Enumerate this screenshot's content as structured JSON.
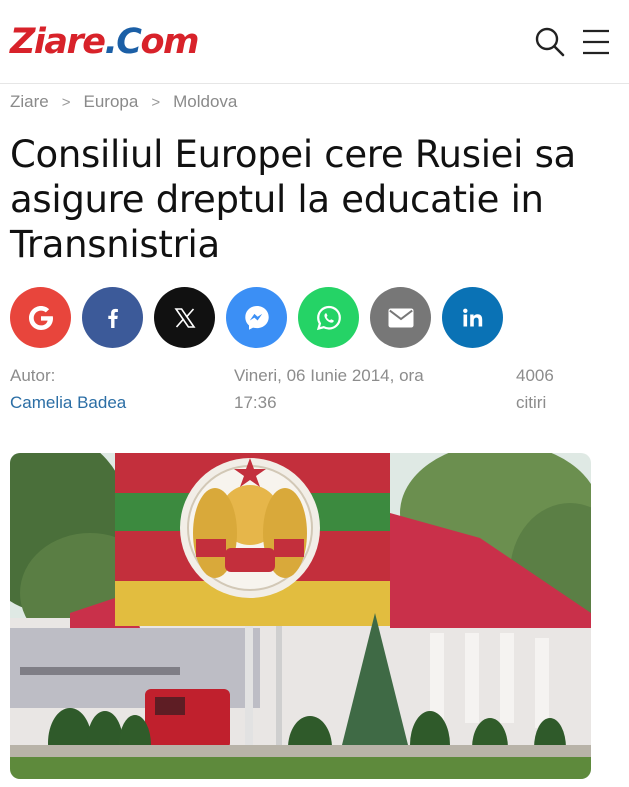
{
  "header": {
    "logo_part1": "Ziare",
    "logo_part2": ".C",
    "logo_part3": "om",
    "search_icon": "search-icon",
    "menu_icon": "hamburger-menu-icon"
  },
  "breadcrumb": {
    "items": [
      "Ziare",
      "Europa",
      "Moldova"
    ],
    "separator": ">"
  },
  "article": {
    "title": "Consiliul Europei cere Rusiei sa asigure dreptul la educatie in Transnistria",
    "author_label": "Autor:",
    "author_name": "Camelia Badea",
    "date_line1": "Vineri, 06 Iunie 2014, ora",
    "date_line2": "17:36",
    "reads_count": "4006",
    "reads_label": "citiri"
  },
  "share": [
    {
      "name": "google",
      "icon": "google-icon",
      "color": "#e8453c"
    },
    {
      "name": "facebook",
      "icon": "facebook-icon",
      "color": "#3c5a99"
    },
    {
      "name": "x",
      "icon": "x-icon",
      "color": "#111111"
    },
    {
      "name": "messenger",
      "icon": "messenger-icon",
      "color": "#3b8ff5"
    },
    {
      "name": "whatsapp",
      "icon": "whatsapp-icon",
      "color": "#25d366"
    },
    {
      "name": "email",
      "icon": "email-icon",
      "color": "#777777"
    },
    {
      "name": "linkedin",
      "icon": "linkedin-icon",
      "color": "#0a72b5"
    }
  ],
  "colors": {
    "logo_red": "#d8222a",
    "logo_blue": "#1b5fa6",
    "link": "#2b6ea5",
    "meta_gray": "#8c8c8c"
  }
}
